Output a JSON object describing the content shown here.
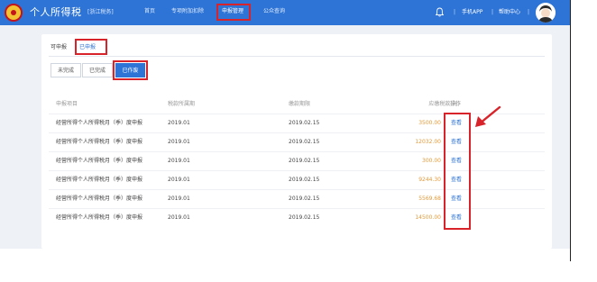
{
  "header": {
    "app_title": "个人所得税",
    "app_subtitle": "[浙江税务]",
    "nav": [
      "首页",
      "专项附加扣除",
      "申报管理",
      "公众查询"
    ],
    "active_nav": "申报管理",
    "mobile_app": "手机APP",
    "help": "帮助中心",
    "separator": "|"
  },
  "tabs": {
    "items": [
      "可申报",
      "已申报"
    ],
    "active": "已申报"
  },
  "segments": {
    "items": [
      "未完成",
      "已完成",
      "已作废"
    ],
    "active": "已作废"
  },
  "table": {
    "columns": [
      "申报项目",
      "税款所属期",
      "缴款期限",
      "应缴税款(元)",
      "操作"
    ],
    "rows": [
      {
        "item": "经营所得个人所得税月（季）度申报",
        "period": "2019.01",
        "deadline": "2019.02.15",
        "amount": "3500.00",
        "action": "查看"
      },
      {
        "item": "经营所得个人所得税月（季）度申报",
        "period": "2019.01",
        "deadline": "2019.02.15",
        "amount": "12032.00",
        "action": "查看"
      },
      {
        "item": "经营所得个人所得税月（季）度申报",
        "period": "2019.01",
        "deadline": "2019.02.15",
        "amount": "300.00",
        "action": "查看"
      },
      {
        "item": "经营所得个人所得税月（季）度申报",
        "period": "2019.01",
        "deadline": "2019.02.15",
        "amount": "9244.30",
        "action": "查看"
      },
      {
        "item": "经营所得个人所得税月（季）度申报",
        "period": "2019.01",
        "deadline": "2019.02.15",
        "amount": "5569.68",
        "action": "查看"
      },
      {
        "item": "经营所得个人所得税月（季）度申报",
        "period": "2019.01",
        "deadline": "2019.02.15",
        "amount": "14500.00",
        "action": "查看"
      }
    ]
  },
  "colors": {
    "brand_blue": "#2d74d6",
    "highlight_red": "#d8232a",
    "amount_orange": "#e49a3a"
  },
  "icons": [
    "tax-emblem-icon",
    "bell-icon",
    "avatar",
    "red-arrow-icon"
  ]
}
